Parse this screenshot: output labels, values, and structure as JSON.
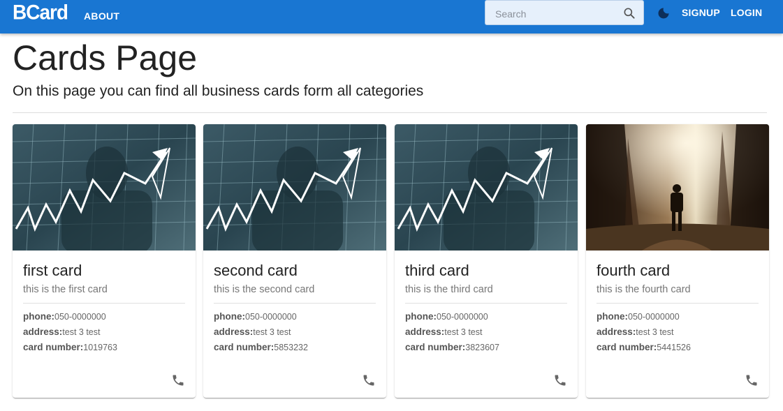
{
  "appbar": {
    "logo": "BCard",
    "about": "ABOUT",
    "search_placeholder": "Search",
    "signup": "SIGNUP",
    "login": "LOGIN",
    "color": "#1976d2"
  },
  "page": {
    "title": "Cards Page",
    "subtitle": "On this page you can find all business cards form all categories"
  },
  "cards": [
    {
      "title": "first card",
      "subtitle": "this is the first card",
      "phone_label": "phone:",
      "phone": "050-0000000",
      "address_label": "address:",
      "address": "test 3 test",
      "number_label": "card number:",
      "number": "1019763",
      "image": "stock-chart-image"
    },
    {
      "title": "second card",
      "subtitle": "this is the second card",
      "phone_label": "phone:",
      "phone": "050-0000000",
      "address_label": "address:",
      "address": "test 3 test",
      "number_label": "card number:",
      "number": "5853232",
      "image": "stock-chart-image"
    },
    {
      "title": "third card",
      "subtitle": "this is the third card",
      "phone_label": "phone:",
      "phone": "050-0000000",
      "address_label": "address:",
      "address": "test 3 test",
      "number_label": "card number:",
      "number": "3823607",
      "image": "stock-chart-image"
    },
    {
      "title": "fourth card",
      "subtitle": "this is the fourth card",
      "phone_label": "phone:",
      "phone": "050-0000000",
      "address_label": "address:",
      "address": "test 3 test",
      "number_label": "card number:",
      "number": "5441526",
      "image": "forest-hiker-image"
    }
  ]
}
